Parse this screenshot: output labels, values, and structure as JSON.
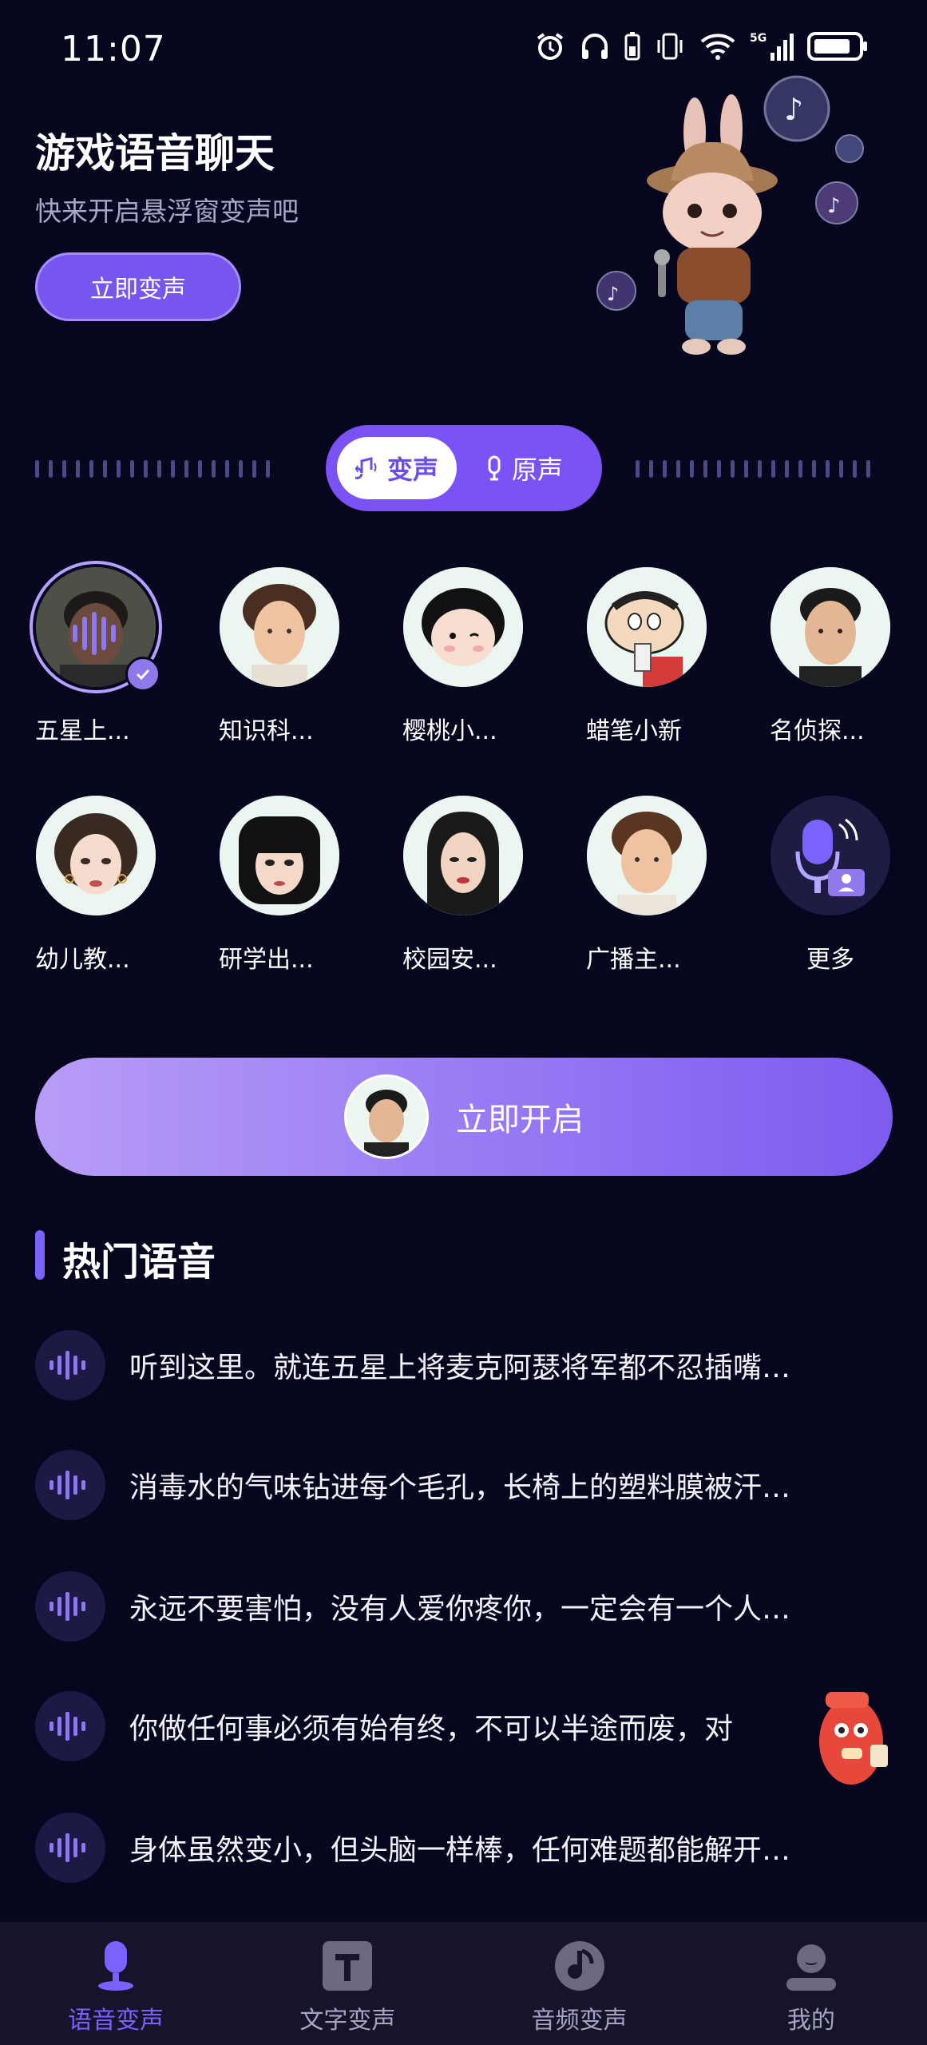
{
  "status_bar": {
    "time": "11:07",
    "network": "5G"
  },
  "banner": {
    "title": "游戏语音聊天",
    "subtitle": "快来开启悬浮窗变声吧",
    "button": "立即变声"
  },
  "toggle": {
    "active": "变声",
    "inactive": "原声"
  },
  "voices": [
    {
      "name": "五星上...",
      "selected": true
    },
    {
      "name": "知识科..."
    },
    {
      "name": "樱桃小..."
    },
    {
      "name": "蜡笔小新"
    },
    {
      "name": "名侦探..."
    },
    {
      "name": "幼儿教..."
    },
    {
      "name": "研学出..."
    },
    {
      "name": "校园安..."
    },
    {
      "name": "广播主..."
    },
    {
      "name": "更多"
    }
  ],
  "start_button": "立即开启",
  "hot": {
    "title": "热门语音",
    "items": [
      "听到这里。就连五星上将麦克阿瑟将军都不忍插嘴…",
      "消毒水的气味钻进每个毛孔，长椅上的塑料膜被汗…",
      "永远不要害怕，没有人爱你疼你，一定会有一个人…",
      "你做任何事必须有始有终，不可以半途而废，对",
      "身体虽然变小，但头脑一样棒，任何难题都能解开…"
    ]
  },
  "tabs": [
    {
      "label": "语音变声",
      "active": true
    },
    {
      "label": "文字变声"
    },
    {
      "label": "音频变声"
    },
    {
      "label": "我的"
    }
  ],
  "colors": {
    "background": "#07061f",
    "accent": "#7b61ff",
    "tabbar": "#15142c"
  }
}
